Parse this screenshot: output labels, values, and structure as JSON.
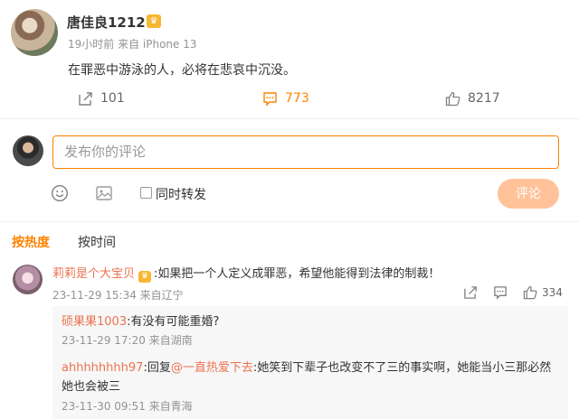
{
  "post": {
    "username": "唐佳良1212",
    "vip_badge": "vip-crown-badge",
    "meta": "19小时前 来自 iPhone 13",
    "text": "在罪恶中游泳的人，必将在悲哀中沉没。",
    "actions": {
      "share_count": "101",
      "comment_count": "773",
      "like_count": "8217"
    }
  },
  "composer": {
    "placeholder": "发布你的评论",
    "repost_label": "同时转发",
    "submit_label": "评论"
  },
  "sort_tabs": {
    "hot": "按热度",
    "time": "按时间"
  },
  "comment": {
    "author": "莉莉是个大宝贝",
    "text": ":如果把一个人定义成罪恶，希望他能得到法律的制裁！",
    "meta": "23-11-29 15:34 来自辽宁",
    "like_count": "334",
    "replies": [
      {
        "author": "硕果果1003",
        "text": ":有没有可能重婚?",
        "meta": "23-11-29 17:20 来自湖南"
      },
      {
        "author": "ahhhhhhhh97",
        "reply_prefix": ":回复",
        "reply_to": "@一直热爱下去",
        "text": ":她笑到下辈子也改变不了三的事实啊，她能当小三那必然她也会被三",
        "meta": "23-11-30 09:51 来自青海"
      }
    ]
  },
  "colors": {
    "accent": "#ff8200",
    "name": "#eb7350",
    "meta": "#939393",
    "submit_disabled": "#ffc299"
  }
}
